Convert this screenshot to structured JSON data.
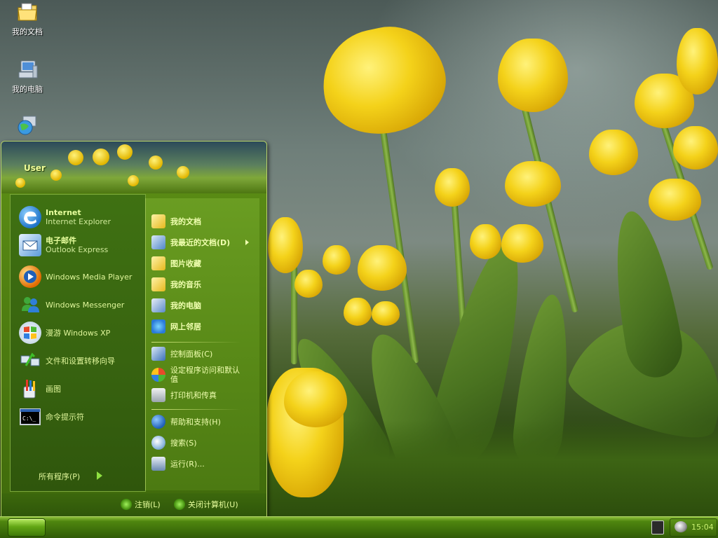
{
  "desktop_icons": [
    {
      "label": "我的文档",
      "icon": "folder-documents-icon"
    },
    {
      "label": "我的电脑",
      "icon": "computer-icon"
    },
    {
      "label": "",
      "icon": "network-globe-icon"
    }
  ],
  "start_menu": {
    "user_name": "User",
    "pinned": [
      {
        "title": "Internet",
        "subtitle": "Internet Explorer",
        "icon": "internet-explorer-icon"
      },
      {
        "title": "电子邮件",
        "subtitle": "Outlook Express",
        "icon": "outlook-express-icon"
      }
    ],
    "programs": [
      {
        "label": "Windows Media Player",
        "icon": "media-player-icon"
      },
      {
        "label": "Windows Messenger",
        "icon": "messenger-icon"
      },
      {
        "label": "漫游 Windows XP",
        "icon": "tour-xp-icon"
      },
      {
        "label": "文件和设置转移向导",
        "icon": "transfer-wizard-icon"
      },
      {
        "label": "画图",
        "icon": "paint-icon"
      },
      {
        "label": "命令提示符",
        "icon": "command-prompt-icon"
      }
    ],
    "all_programs": "所有程序(P)",
    "places": [
      {
        "label": "我的文档",
        "icon": "my-documents-icon"
      },
      {
        "label": "我最近的文档(D)",
        "icon": "recent-documents-icon"
      },
      {
        "label": "图片收藏",
        "icon": "my-pictures-icon"
      },
      {
        "label": "我的音乐",
        "icon": "my-music-icon"
      },
      {
        "label": "我的电脑",
        "icon": "my-computer-icon"
      },
      {
        "label": "网上邻居",
        "icon": "network-places-icon"
      }
    ],
    "system": [
      {
        "label": "控制面板(C)",
        "icon": "control-panel-icon"
      },
      {
        "label": "设定程序访问和默认值",
        "icon": "program-access-icon"
      },
      {
        "label": "打印机和传真",
        "icon": "printer-icon"
      }
    ],
    "help": [
      {
        "label": "帮助和支持(H)",
        "icon": "help-icon"
      },
      {
        "label": "搜索(S)",
        "icon": "search-icon"
      },
      {
        "label": "运行(R)...",
        "icon": "run-icon"
      }
    ],
    "logoff": "注销(L)",
    "shutdown": "关闭计算机(U)"
  },
  "taskbar": {
    "clock": "15:04"
  },
  "colors": {
    "accent_green": "#4f860f",
    "menu_text": "#e8ff9e"
  }
}
